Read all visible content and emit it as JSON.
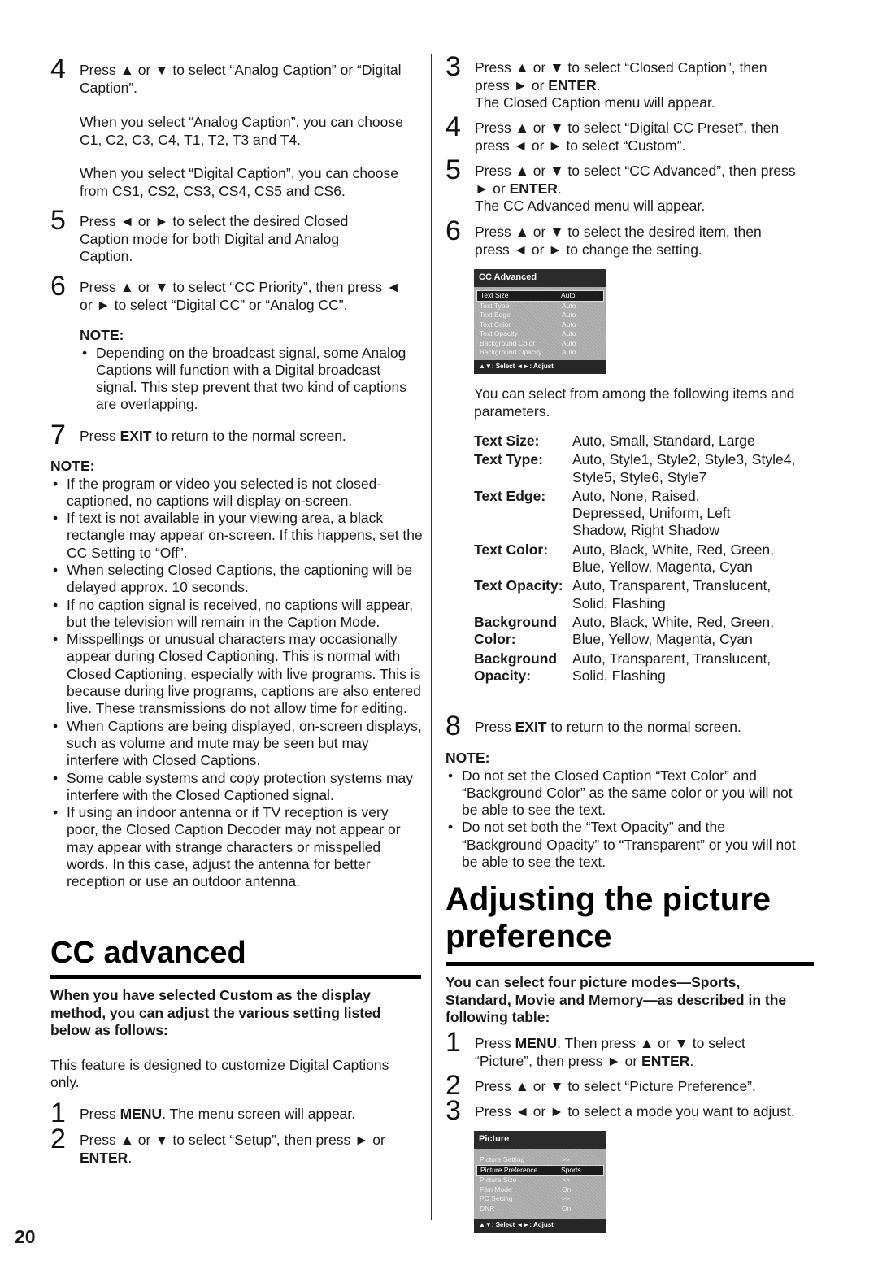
{
  "page_number": "20",
  "left": {
    "step4": {
      "num": "4",
      "text": "Press ▲ or ▼ to select “Analog Caption” or “Digital Caption”."
    },
    "step4_para1": "When you select “Analog Caption”, you can choose C1, C2, C3, C4, T1, T2, T3 and T4.",
    "step4_para2": "When you select “Digital Caption”, you can choose from CS1, CS2, CS3, CS4, CS5 and CS6.",
    "step5": {
      "num": "5",
      "text": "Press ◄ or ► to select the desired Closed Caption mode for both Digital and Analog Caption."
    },
    "step6": {
      "num": "6",
      "text": "Press ▲ or ▼ to select  “CC Priority”, then press ◄ or ► to select “Digital CC” or “Analog CC”."
    },
    "note1": {
      "heading": "NOTE:",
      "items": [
        "Depending on the broadcast signal, some Analog Captions will function with a Digital broadcast signal. This step prevent that two kind of captions are overlapping."
      ]
    },
    "step7": {
      "num": "7",
      "pre": "Press ",
      "bold": "EXIT",
      "post": " to return to the normal screen."
    },
    "note2": {
      "heading": "NOTE:",
      "items": [
        "If the program or video you selected is not closed-captioned, no captions will display on-screen.",
        "If text is not available in your viewing area, a black rectangle may appear on-screen. If this happens, set the CC Setting to “Off”.",
        "When selecting Closed Captions, the captioning will be delayed approx. 10 seconds.",
        "If no caption signal is received, no captions will appear, but the television will remain in the Caption Mode.",
        "Misspellings or unusual characters may occasionally appear during Closed Captioning. This is normal with Closed Captioning, especially with live programs. This is because during live programs, captions are also entered live. These transmissions do not allow time for editing.",
        "When Captions are being displayed, on-screen displays, such as volume and mute may be seen but may interfere with Closed Captions.",
        "Some cable systems and copy protection systems may interfere with the Closed Captioned signal.",
        "If using an indoor antenna or if TV reception is very poor, the Closed Caption Decoder may not appear or may appear with strange characters or misspelled words. In this case, adjust the antenna for better reception or use an outdoor antenna."
      ]
    },
    "cc_section": {
      "title": "CC advanced",
      "lead": "When you have selected Custom as the display method, you can adjust the various setting listed below as follows:",
      "intro": "This feature is designed to customize Digital Captions only.",
      "step1": {
        "num": "1",
        "pre": "Press ",
        "bold": "MENU",
        "post": ". The menu screen will appear."
      },
      "step2": {
        "num": "2",
        "pre": "Press ▲ or ▼ to select “Setup”, then press ► or ",
        "bold": "ENTER",
        "post": "."
      }
    }
  },
  "right": {
    "step3": {
      "num": "3",
      "pre": "Press ▲ or ▼ to select “Closed Caption”, then press ► or ",
      "bold": "ENTER",
      "post": ".",
      "line2": "The Closed Caption menu will appear."
    },
    "step4": {
      "num": "4",
      "text": "Press ▲ or ▼ to select “Digital CC Preset”, then press ◄ or ► to select “Custom”."
    },
    "step5": {
      "num": "5",
      "pre": "Press ▲ or ▼ to select  “CC Advanced”, then press ► or ",
      "bold": "ENTER",
      "post": ".",
      "line2": "The CC Advanced menu will appear."
    },
    "step6": {
      "num": "6",
      "text": "Press ▲ or ▼ to select the desired item, then press ◄ or ► to change the setting."
    },
    "cc_menu": {
      "title": "CC Advanced",
      "items": [
        {
          "label": "Text Size",
          "value": "Auto",
          "selected": true
        },
        {
          "label": "Text Type",
          "value": "Auto"
        },
        {
          "label": "Text Edge",
          "value": "Auto"
        },
        {
          "label": "Text Color",
          "value": "Auto"
        },
        {
          "label": "Text Opacity",
          "value": "Auto"
        },
        {
          "label": "Background Color",
          "value": "Auto"
        },
        {
          "label": "Background Opacity",
          "value": "Auto"
        }
      ],
      "footer": "▲▼: Select   ◄►: Adjust"
    },
    "params_intro": "You can select from among the following items and parameters.",
    "params": [
      {
        "key": "Text Size:",
        "value": "Auto, Small, Standard, Large"
      },
      {
        "key": "Text Type:",
        "value": "Auto, Style1, Style2, Style3, Style4, Style5, Style6, Style7"
      },
      {
        "key": "Text Edge:",
        "value": "Auto, None, Raised, Depressed, Uniform, Left Shadow, Right Shadow"
      },
      {
        "key": "Text Color:",
        "value": "Auto, Black, White, Red, Green, Blue, Yellow, Magenta, Cyan"
      },
      {
        "key": "Text Opacity:",
        "value": "Auto, Transparent, Translucent, Solid, Flashing"
      },
      {
        "key": "Background Color:",
        "value": "Auto, Black, White, Red, Green, Blue, Yellow, Magenta, Cyan"
      },
      {
        "key": "Background Opacity:",
        "value": "Auto, Transparent, Translucent, Solid, Flashing"
      }
    ],
    "step8": {
      "num": "8",
      "pre": "Press ",
      "bold": "EXIT",
      "post": " to return to the normal screen."
    },
    "note": {
      "heading": "NOTE:",
      "items": [
        "Do not set the Closed Caption “Text Color” and “Background Color” as the same color or you will not be able to see the text.",
        "Do not set both the “Text Opacity” and the “Background Opacity” to “Transparent” or you will not be able to see the text."
      ]
    },
    "picture_section": {
      "title": "Adjusting the picture preference",
      "lead": "You can select four picture modes—Sports, Standard, Movie and Memory—as described in the following table:",
      "step1": {
        "num": "1",
        "pre": "Press ",
        "bold": "MENU",
        "mid": ". Then press ▲ or ▼ to select “Picture”, then press ► or ",
        "bold2": "ENTER",
        "post": "."
      },
      "step2": {
        "num": "2",
        "text": "Press ▲ or ▼ to select “Picture Preference”."
      },
      "step3": {
        "num": "3",
        "text": "Press ◄ or ► to select a mode you want to adjust."
      }
    },
    "picture_menu": {
      "title": "Picture",
      "items": [
        {
          "label": "Picture Setting",
          "value": ">>"
        },
        {
          "label": "Picture Preference",
          "value": "Sports",
          "selected": true
        },
        {
          "label": "Picture Size",
          "value": ">>"
        },
        {
          "label": "Film Mode",
          "value": "On"
        },
        {
          "label": "PC Setting",
          "value": ">>"
        },
        {
          "label": "DNR",
          "value": "On"
        }
      ],
      "footer": "▲▼: Select   ◄►: Adjust"
    }
  }
}
